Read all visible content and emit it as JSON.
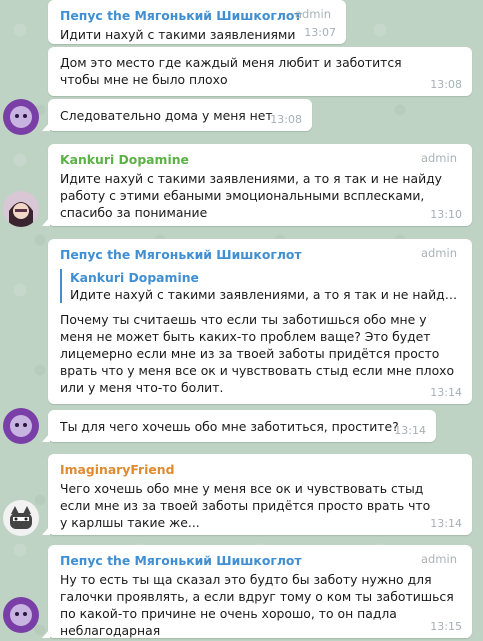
{
  "colors": {
    "pepus_name": "#3f8fd2",
    "kankuri_name": "#5bb146",
    "imaginary_name": "#e08a2e",
    "background": "#bed3c4"
  },
  "messages": [
    {
      "sender": "Пепус the Мягонький Шишкоглот",
      "badge": "admin",
      "text": "Идити нахуй с такими заявлениями",
      "time": "13:07"
    },
    {
      "text": "Дом это место где каждый меня любит и заботится чтобы мне не было плохо",
      "time": "13:08"
    },
    {
      "text": "Следовательно дома у меня нет",
      "time": "13:08"
    },
    {
      "sender": "Kankuri Dopamine",
      "badge": "admin",
      "text": "Идите нахуй с такими заявлениями, а то я так и не найду работу с этими ебаными эмоциональными всплесками, спасибо за понимание",
      "time": "13:10"
    },
    {
      "sender": "Пепус the Мягонький Шишкоглот",
      "badge": "admin",
      "reply_name": "Kankuri Dopamine",
      "reply_text": "Идите нахуй с такими заявлениями, а то я так и не найду раб...",
      "text": "Почему ты считаешь что если ты заботишься обо мне у меня не может быть каких-то проблем ваще? Это будет лицемерно если мне из за твоей заботы придётся просто врать что у меня все ок и чувствовать стыд если мне плохо или у меня что-то болит.",
      "time": "13:14"
    },
    {
      "text": "Ты для чего хочешь обо мне заботиться, простите?",
      "time": "13:14"
    },
    {
      "sender": "ImaginaryFriend",
      "text": "Чего хочешь обо мне у меня все ок и чувствовать стыд если мне из за твоей заботы придётся просто врать что у карлшы такие же...",
      "time": "13:14"
    },
    {
      "sender": "Пепус the Мягонький Шишкоглот",
      "badge": "admin",
      "text": "Ну то есть ты ща сказал это будто бы заботу нужно для галочки проявлять, а если вдруг тому о ком ты заботишься по какой-то причине не очень хорошо, то он падла неблагодарная",
      "time": "13:15"
    }
  ]
}
